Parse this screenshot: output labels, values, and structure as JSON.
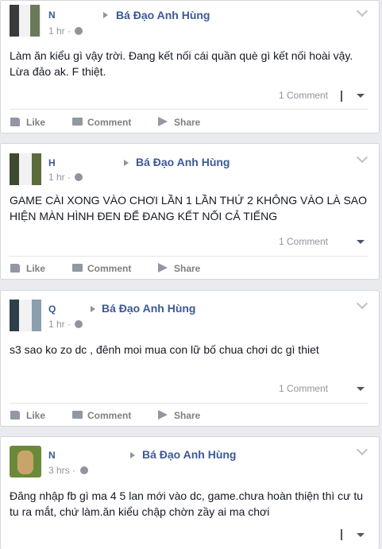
{
  "posts": [
    {
      "author": "N",
      "group": "Bá Đạo Anh Hùng",
      "time": "1 hr ·",
      "text": "Làm ăn kiểu gì vậy trời. Đang kết nối cái quần què gì kết nối hoài vậy. Lừa đảo ak. F thiệt.",
      "comments": "1 Comment",
      "actions": {
        "like": "Like",
        "comment": "Comment",
        "share": "Share"
      }
    },
    {
      "author": "H",
      "group": "Bá Đạo Anh Hùng",
      "time": "1 hr ·",
      "text": "GAME CÀI XONG VÀO CHƠI LẦN 1 LẦN THỨ 2 KHÔNG VÀO LÀ SAO HIỆN MÀN HÌNH ĐEN ĐỂ ĐANG KẾT NỐI CẢ TIẾNG",
      "comments": "1 Comment",
      "actions": {
        "like": "Like",
        "comment": "Comment",
        "share": "Share"
      }
    },
    {
      "author": "Q",
      "group": "Bá Đạo Anh Hùng",
      "time": "1 hr ·",
      "text": "s3 sao ko zo dc , đênh moi mua con lữ bố chua chơi dc gì thiet",
      "comments": "1 Comment",
      "actions": {
        "like": "Like",
        "comment": "Comment",
        "share": "Share"
      }
    },
    {
      "author": "N",
      "group": "Bá Đạo Anh Hùng",
      "time": "3 hrs ·",
      "text": "Đăng nhập fb gì ma 4 5 lan mới vào dc, game.chưa hoàn thiện thì cư tu tu ra mắt, chứ làm.ăn kiểu chập chờn zầy ai ma chơi"
    }
  ],
  "colors": {
    "link": "#3b5998",
    "meta": "#90949c",
    "background": "#e9ebee"
  },
  "icons": [
    "like-icon",
    "comment-icon",
    "share-icon",
    "globe-icon",
    "chevron-down-icon",
    "caret-down-icon"
  ]
}
